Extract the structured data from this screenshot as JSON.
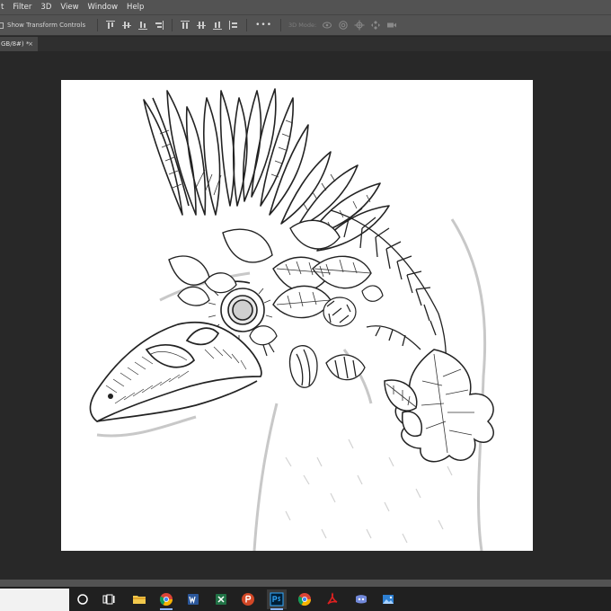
{
  "menu": {
    "items": [
      "t",
      "Filter",
      "3D",
      "View",
      "Window",
      "Help"
    ]
  },
  "options": {
    "show_transform_controls": "Show Transform Controls",
    "dots": "•••",
    "mode_3d": "3D Mode:"
  },
  "tab": {
    "title": "GB/8#) *",
    "close": "×"
  },
  "colors": {
    "panel": "#535353",
    "workspace": "#282828",
    "canvas": "#ffffff",
    "taskbar": "#202020",
    "active_tab": "#464646"
  },
  "icons": [
    "align-top-icon",
    "align-vcenter-icon",
    "align-bottom-icon",
    "align-left-icon",
    "align-hcenter-icon",
    "align-right-icon",
    "distribute-top-icon",
    "distribute-vcenter-icon",
    "distribute-bottom-icon",
    "distribute-left-icon",
    "orbit-3d-icon",
    "roll-3d-icon",
    "pan-3d-icon",
    "slide-3d-icon",
    "video-3d-icon"
  ],
  "taskbar": {
    "apps": [
      "cortana",
      "task-view",
      "file-explorer",
      "chrome",
      "word",
      "excel",
      "powerpoint",
      "photoshop",
      "chrome",
      "acrobat",
      "discord",
      "photos"
    ]
  }
}
